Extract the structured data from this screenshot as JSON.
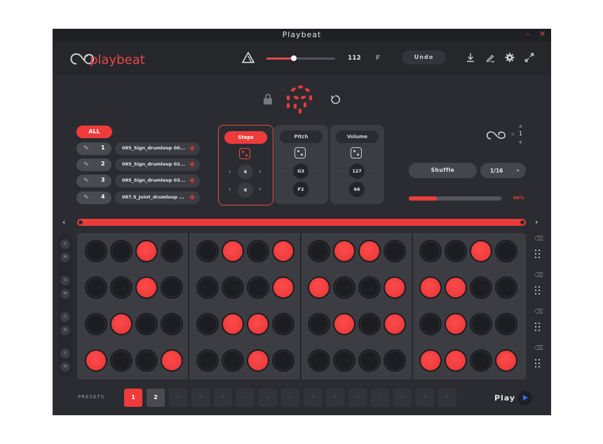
{
  "window": {
    "title": "Playbeat",
    "minimize": "–",
    "close": "✕"
  },
  "header": {
    "logo_text": "playbeat",
    "tempo_value": "112",
    "key_label": "F",
    "undo_label": "Undo",
    "icons": [
      "triangle-icon",
      "download-icon",
      "pencil-icon",
      "gear-icon",
      "expand-icon"
    ]
  },
  "tracks": {
    "all_label": "ALL",
    "items": [
      {
        "num": "1",
        "wave": "-\u0005-",
        "file": "085_Sign_drumloop 00..."
      },
      {
        "num": "2",
        "wave": "-\u0005-",
        "file": "085_Sign_drumloop 02..."
      },
      {
        "num": "3",
        "wave": "-\u0005-",
        "file": "085_Sign_drumloop 03..."
      },
      {
        "num": "4",
        "wave": "-\u0005-",
        "file": "087.5_Joint_drumloop ..."
      }
    ]
  },
  "modes": [
    {
      "label": "Steps",
      "active": true,
      "top": "6",
      "bottom": "6"
    },
    {
      "label": "Pitch",
      "active": false,
      "top": "G3",
      "bottom": "F2"
    },
    {
      "label": "Volume",
      "active": false,
      "top": "127",
      "bottom": "66"
    }
  ],
  "loop": {
    "multiplier": "×",
    "count": "1"
  },
  "shuffle_label": "Shuffle",
  "division": {
    "value": "1/16",
    "chevron": "⌄"
  },
  "progress": {
    "value": 0.3,
    "label": "66%"
  },
  "nav": {
    "prev": "‹",
    "next": "›"
  },
  "solo_mute": [
    "S",
    "M",
    "S",
    "M",
    "S",
    "M",
    "S",
    "M"
  ],
  "pattern": [
    [
      0,
      0,
      1,
      0,
      0,
      1,
      0,
      1,
      0,
      1,
      1,
      0,
      0,
      0,
      1,
      0
    ],
    [
      0,
      0,
      1,
      0,
      0,
      0,
      0,
      1,
      1,
      0,
      0,
      1,
      1,
      1,
      0,
      0
    ],
    [
      0,
      1,
      0,
      0,
      0,
      1,
      1,
      0,
      0,
      1,
      0,
      1,
      0,
      1,
      0,
      0
    ],
    [
      1,
      0,
      0,
      1,
      0,
      0,
      1,
      0,
      0,
      0,
      0,
      0,
      1,
      1,
      0,
      1
    ]
  ],
  "presets": {
    "label": "PRESETS",
    "slots": [
      "1",
      "2",
      "+",
      "+",
      "+",
      "+",
      "+",
      "+",
      "+",
      "+",
      "+",
      "+",
      "+",
      "+",
      "+"
    ]
  },
  "play_label": "Play"
}
